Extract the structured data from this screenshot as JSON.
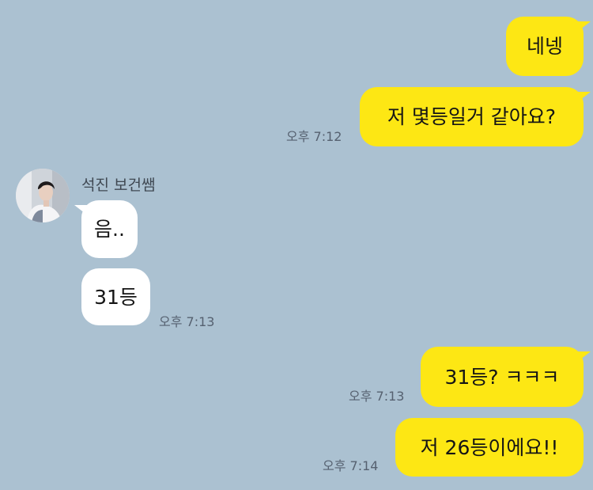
{
  "sender": {
    "name": "석진 보건쌤"
  },
  "messages": [
    {
      "from": "me",
      "text": "네넹"
    },
    {
      "from": "me",
      "text": "저 몇등일거 같아요?",
      "time": "오후 7:12"
    },
    {
      "from": "them",
      "text": "음.."
    },
    {
      "from": "them",
      "text": "31등",
      "time": "오후 7:13"
    },
    {
      "from": "me",
      "text": "31등? ㅋㅋㅋ",
      "time": "오후 7:13"
    },
    {
      "from": "me",
      "text": "저 26등이에요!!",
      "time": "오후 7:14"
    }
  ],
  "colors": {
    "background": "#abc1d1",
    "my_bubble": "#fde714",
    "their_bubble": "#ffffff",
    "timestamp": "#566170"
  },
  "icons": {
    "avatar": "profile-photo"
  }
}
